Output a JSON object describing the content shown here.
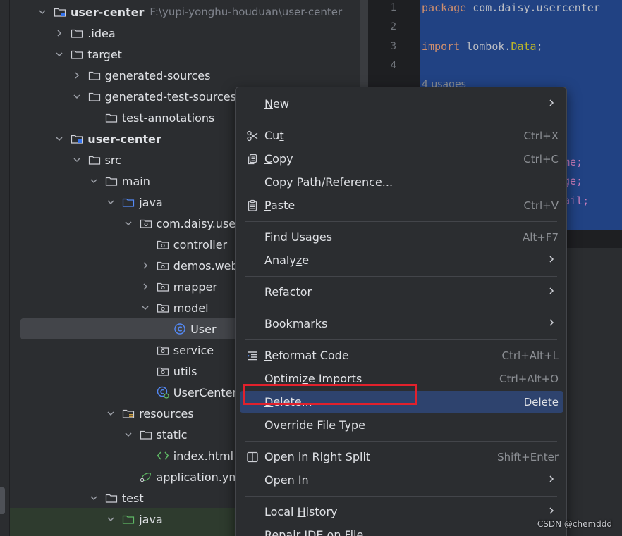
{
  "tree": {
    "rows": [
      {
        "label": "user-center",
        "path": "F:\\yupi-yonghu-houduan\\user-center",
        "bold": true,
        "level": 0,
        "chevron": "down",
        "icon": "module-folder-icon"
      },
      {
        "label": ".idea",
        "level": 1,
        "chevron": "right",
        "icon": "folder-icon"
      },
      {
        "label": "target",
        "level": 1,
        "chevron": "down",
        "icon": "folder-icon"
      },
      {
        "label": "generated-sources",
        "level": 2,
        "chevron": "right",
        "icon": "folder-icon"
      },
      {
        "label": "generated-test-sources",
        "level": 2,
        "chevron": "down",
        "icon": "folder-icon"
      },
      {
        "label": "test-annotations",
        "level": 3,
        "chevron": "none",
        "icon": "folder-icon"
      },
      {
        "label": "user-center",
        "bold": true,
        "level": 1,
        "chevron": "down",
        "icon": "module-folder-icon"
      },
      {
        "label": "src",
        "level": 2,
        "chevron": "down",
        "icon": "folder-icon"
      },
      {
        "label": "main",
        "level": 3,
        "chevron": "down",
        "icon": "folder-icon"
      },
      {
        "label": "java",
        "level": 4,
        "chevron": "down",
        "icon": "source-folder-icon"
      },
      {
        "label": "com.daisy.usercen",
        "level": 5,
        "chevron": "down",
        "icon": "package-icon"
      },
      {
        "label": "controller",
        "level": 6,
        "chevron": "none",
        "icon": "package-icon"
      },
      {
        "label": "demos.web",
        "level": 6,
        "chevron": "right",
        "icon": "package-icon"
      },
      {
        "label": "mapper",
        "level": 6,
        "chevron": "right",
        "icon": "package-icon"
      },
      {
        "label": "model",
        "level": 6,
        "chevron": "down",
        "icon": "package-icon"
      },
      {
        "label": "User",
        "level": 7,
        "chevron": "none",
        "icon": "java-class-icon",
        "selected": true
      },
      {
        "label": "service",
        "level": 6,
        "chevron": "none",
        "icon": "package-icon"
      },
      {
        "label": "utils",
        "level": 6,
        "chevron": "none",
        "icon": "package-icon"
      },
      {
        "label": "UserCenterApp",
        "level": 6,
        "chevron": "none",
        "icon": "spring-app-class-icon"
      },
      {
        "label": "resources",
        "level": 4,
        "chevron": "down",
        "icon": "resources-folder-icon"
      },
      {
        "label": "static",
        "level": 5,
        "chevron": "down",
        "icon": "folder-icon"
      },
      {
        "label": "index.html",
        "level": 6,
        "chevron": "none",
        "icon": "html-file-icon"
      },
      {
        "label": "application.yml",
        "level": 5,
        "chevron": "none",
        "icon": "spring-yml-icon"
      },
      {
        "label": "test",
        "level": 3,
        "chevron": "down",
        "icon": "folder-icon"
      },
      {
        "label": "java",
        "level": 4,
        "chevron": "down",
        "icon": "test-source-folder-icon"
      }
    ]
  },
  "editor": {
    "line_numbers": [
      "1",
      "2",
      "3",
      "4"
    ],
    "line1": {
      "kw": "package",
      "rest": " com.daisy.usercenter"
    },
    "line3": {
      "kw": "import",
      "pre": " lombok.",
      "cls": "Data",
      "post": ";"
    },
    "usages": "4 usages",
    "field1": "ame;",
    "field2": "age;",
    "field3": "nail;"
  },
  "menu": {
    "items": [
      {
        "label": "New",
        "mnemonic": "N",
        "submenu": true
      },
      {
        "separator": true
      },
      {
        "label": "Cut",
        "mnemonic": "t",
        "shortcut": "Ctrl+X",
        "icon": "scissors-icon"
      },
      {
        "label": "Copy",
        "mnemonic": "C",
        "shortcut": "Ctrl+C",
        "icon": "copy-icon"
      },
      {
        "label": "Copy Path/Reference..."
      },
      {
        "label": "Paste",
        "mnemonic": "P",
        "shortcut": "Ctrl+V",
        "icon": "paste-icon"
      },
      {
        "separator": true
      },
      {
        "label": "Find Usages",
        "mnemonic": "U",
        "shortcut": "Alt+F7"
      },
      {
        "label": "Analyze",
        "mnemonic": "z",
        "submenu": true
      },
      {
        "separator": true
      },
      {
        "label": "Refactor",
        "mnemonic": "R",
        "submenu": true
      },
      {
        "separator": true
      },
      {
        "label": "Bookmarks",
        "submenu": true
      },
      {
        "separator": true
      },
      {
        "label": "Reformat Code",
        "mnemonic": "R",
        "shortcut": "Ctrl+Alt+L",
        "icon": "reformat-icon"
      },
      {
        "label": "Optimize Imports",
        "mnemonic": "z",
        "shortcut": "Ctrl+Alt+O"
      },
      {
        "label": "Delete...",
        "mnemonic": "D",
        "shortcut": "Delete",
        "active": true
      },
      {
        "label": "Override File Type"
      },
      {
        "separator": true
      },
      {
        "label": "Open in Right Split",
        "shortcut": "Shift+Enter",
        "icon": "split-icon"
      },
      {
        "label": "Open In",
        "submenu": true
      },
      {
        "separator": true
      },
      {
        "label": "Local History",
        "mnemonic": "H",
        "submenu": true
      },
      {
        "label": "Repair IDE on File"
      }
    ]
  },
  "watermark": "CSDN @chemddd",
  "colors": {
    "accent_selected": "#2e436e",
    "highlight_box": "#e2212c",
    "editor_selection": "#214283"
  }
}
